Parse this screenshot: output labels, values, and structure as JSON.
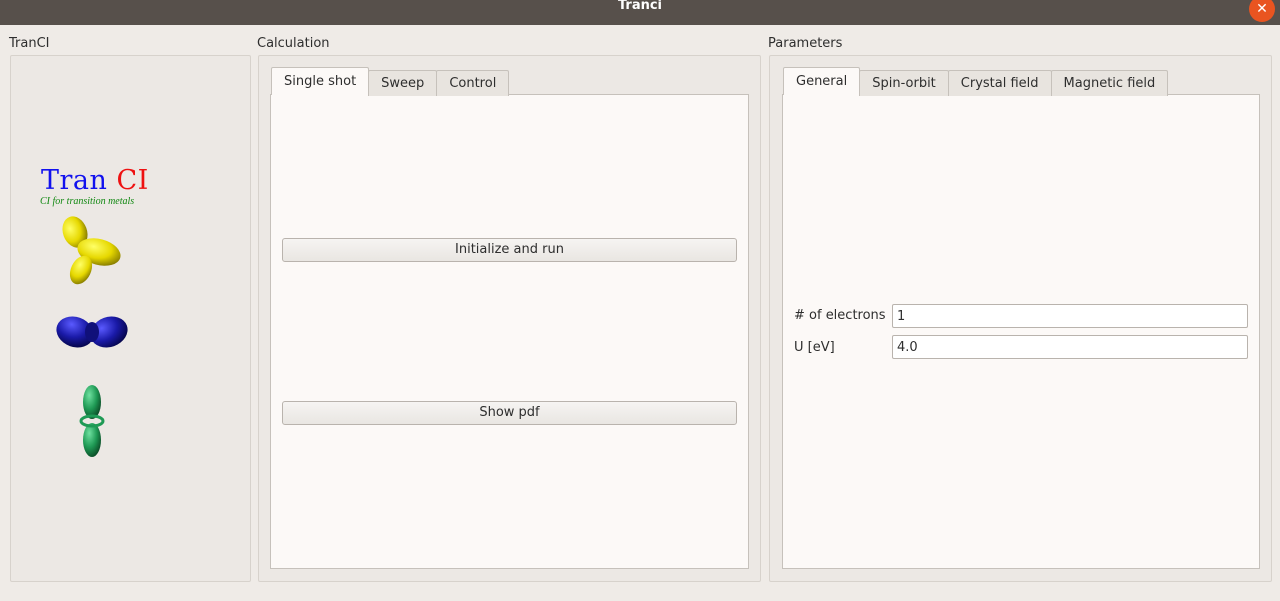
{
  "window": {
    "title": "Tranci",
    "close_glyph": "✕"
  },
  "left_panel": {
    "label": "TranCI",
    "logo_tran": "Tran",
    "logo_ci": "CI",
    "logo_subtitle": "CI for transition metals",
    "orbitals": [
      {
        "name": "yellow-d-orbital",
        "color": "#e6d800"
      },
      {
        "name": "blue-d-orbital",
        "color": "#1a1aa8"
      },
      {
        "name": "green-dz2-orbital",
        "color": "#1f9a55"
      }
    ]
  },
  "calculation": {
    "label": "Calculation",
    "tabs": [
      {
        "label": "Single shot",
        "active": true
      },
      {
        "label": "Sweep",
        "active": false
      },
      {
        "label": "Control",
        "active": false
      }
    ],
    "init_run_label": "Initialize and run",
    "show_pdf_label": "Show pdf"
  },
  "parameters": {
    "label": "Parameters",
    "tabs": [
      {
        "label": "General",
        "active": true
      },
      {
        "label": "Spin-orbit",
        "active": false
      },
      {
        "label": "Crystal field",
        "active": false
      },
      {
        "label": "Magnetic field",
        "active": false
      }
    ],
    "electrons_label": "# of electrons",
    "electrons_value": "1",
    "u_label": "U [eV]",
    "u_value": "4.0"
  },
  "colors": {
    "titlebar": "#57504b",
    "close": "#e95420",
    "background": "#efebe7",
    "panel": "#fcf9f7"
  }
}
